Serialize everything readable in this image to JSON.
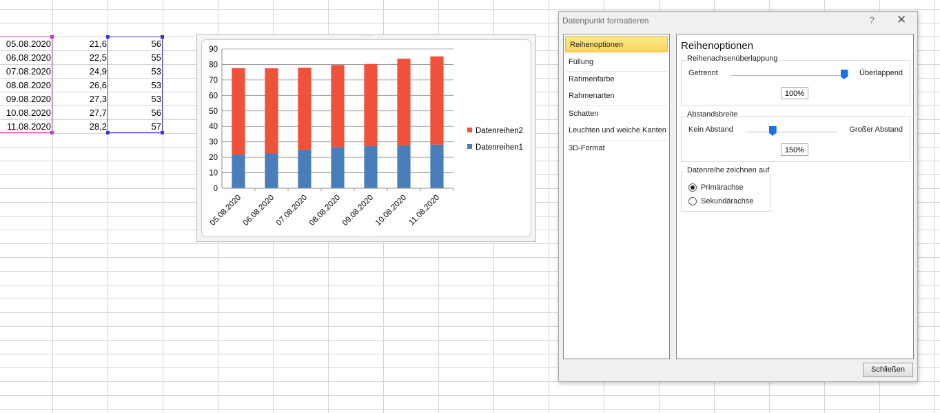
{
  "sheet": {
    "rows": [
      {
        "date": "05.08.2020",
        "v1": "21,6",
        "v2": "56"
      },
      {
        "date": "06.08.2020",
        "v1": "22,5",
        "v2": "55"
      },
      {
        "date": "07.08.2020",
        "v1": "24,9",
        "v2": "53"
      },
      {
        "date": "08.08.2020",
        "v1": "26,6",
        "v2": "53"
      },
      {
        "date": "09.08.2020",
        "v1": "27,3",
        "v2": "53"
      },
      {
        "date": "10.08.2020",
        "v1": "27,7",
        "v2": "56"
      },
      {
        "date": "11.08.2020",
        "v1": "28,2",
        "v2": "57"
      }
    ]
  },
  "chart_data": {
    "type": "bar",
    "stacked": true,
    "categories": [
      "05.08.2020",
      "06.08.2020",
      "07.08.2020",
      "08.08.2020",
      "09.08.2020",
      "10.08.2020",
      "11.08.2020"
    ],
    "series": [
      {
        "name": "Datenreihen1",
        "color": "#4a7ebb",
        "values": [
          21.6,
          22.5,
          24.9,
          26.6,
          27.3,
          27.7,
          28.2
        ]
      },
      {
        "name": "Datenreihen2",
        "color": "#f0513a",
        "values": [
          56,
          55,
          53,
          53,
          53,
          56,
          57
        ]
      }
    ],
    "ylim": [
      0,
      90
    ],
    "yticks": [
      "0",
      "10",
      "20",
      "30",
      "40",
      "50",
      "60",
      "70",
      "80",
      "90"
    ],
    "grid": true,
    "legend_position": "right"
  },
  "dialog": {
    "title": "Datenpunkt formatieren",
    "help": "?",
    "close": "✕",
    "nav": [
      {
        "label": "Reihenoptionen",
        "active": true
      },
      {
        "label": "Füllung"
      },
      {
        "label": "Rahmenfarbe"
      },
      {
        "label": "Rahmenarten"
      },
      {
        "label": "Schatten"
      },
      {
        "label": "Leuchten und weiche Kanten"
      },
      {
        "label": "3D-Format"
      }
    ],
    "panel_title": "Reihenoptionen",
    "overlap": {
      "label": "Reihenachsenüberlappung",
      "left": "Getrennt",
      "right": "Überlappend",
      "value": "100%",
      "fraction": 1.0
    },
    "gap": {
      "label": "Abstandsbreite",
      "left": "Kein Abstand",
      "right": "Großer Abstand",
      "value": "150%",
      "fraction": 0.3
    },
    "axis": {
      "label": "Datenreihe zeichnen auf",
      "primary": "Primärachse",
      "secondary": "Sekundärachse",
      "selected": "primary"
    },
    "close_button": "Schließen"
  }
}
